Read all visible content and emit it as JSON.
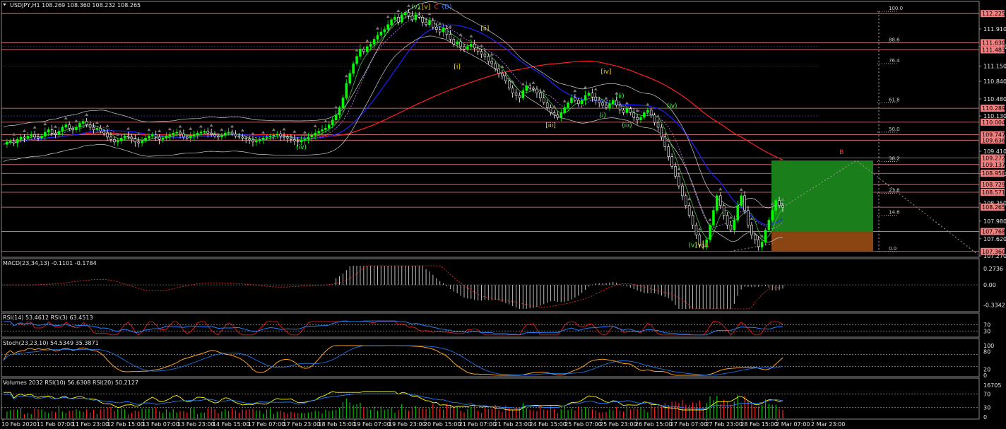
{
  "window": {
    "title": "USDJPY,H1  108.269 108.360 108.232 108.265"
  },
  "colors": {
    "background": "#000000",
    "grid": "#2a2a2a",
    "bull_candle": "#00ff00",
    "bear_candle": "#ffffff",
    "level_line": "#f08080",
    "ma_blue": "#2020ff",
    "ma_red": "#ff2020",
    "green_box": "#1a7f1a",
    "brown_box": "#8b4513",
    "macd_hist": "#c0c0c0",
    "macd_signal": "#ff3030",
    "rsi_fast": "#ff2020",
    "rsi_slow": "#2080ff",
    "stoch_main": "#ffa020",
    "stoch_signal": "#2080ff",
    "vol_up": "#00c000",
    "vol_down": "#ff2020",
    "vol_rsi_fast": "#ffff00",
    "vol_rsi_slow": "#2080ff"
  },
  "chart_data": [
    {
      "type": "candlestick",
      "title": "USDJPY,H1  108.269 108.360 108.232 108.265",
      "symbol": "USDJPY",
      "timeframe": "H1",
      "ohlc_last": {
        "open": 108.269,
        "high": 108.36,
        "low": 108.232,
        "close": 108.265
      },
      "ylim": [
        107.27,
        112.3
      ],
      "y_ticks": [
        "111.910",
        "111.550",
        "111.150",
        "110.840",
        "110.480",
        "110.130",
        "109.410",
        "108.950",
        "108.350",
        "107.980",
        "107.620",
        "107.270"
      ],
      "x_labels": [
        "10 Feb 2020",
        "11 Feb 07:00",
        "11 Feb 23:00",
        "12 Feb 15:00",
        "13 Feb 07:00",
        "13 Feb 23:00",
        "14 Feb 15:00",
        "17 Feb 07:00",
        "17 Feb 23:00",
        "18 Feb 15:00",
        "19 Feb 07:00",
        "19 Feb 23:00",
        "20 Feb 15:00",
        "21 Feb 07:00",
        "21 Feb 23:00",
        "24 Feb 15:00",
        "25 Feb 07:00",
        "25 Feb 23:00",
        "26 Feb 15:00",
        "27 Feb 07:00",
        "27 Feb 23:00",
        "28 Feb 15:00",
        "2 Mar 07:00",
        "2 Mar 23:00"
      ],
      "price_levels": [
        {
          "value": 112.225,
          "label": "112.225"
        },
        {
          "value": 111.63,
          "label": "111.630"
        },
        {
          "value": 111.483,
          "label": "111.483"
        },
        {
          "value": 110.289,
          "label": "110.289"
        },
        {
          "value": 110.004,
          "label": "110.004"
        },
        {
          "value": 109.747,
          "label": "109.747"
        },
        {
          "value": 109.636,
          "label": "109.636"
        },
        {
          "value": 109.272,
          "label": "109.272"
        },
        {
          "value": 109.137,
          "label": "109.137"
        },
        {
          "value": 108.958,
          "label": "108.958"
        },
        {
          "value": 108.729,
          "label": "108.729"
        },
        {
          "value": 108.571,
          "label": "108.571"
        },
        {
          "value": 108.265,
          "label": "108.265"
        },
        {
          "value": 107.768,
          "label": "107.768"
        },
        {
          "value": 107.36,
          "label": "107.360"
        }
      ],
      "fib_levels": [
        {
          "label": "100.0",
          "value": 112.27
        },
        {
          "label": "88.6",
          "value": 111.63
        },
        {
          "label": "76.4",
          "value": 111.2
        },
        {
          "label": "61.8",
          "value": 110.4
        },
        {
          "label": "50.0",
          "value": 109.8
        },
        {
          "label": "38.2",
          "value": 109.2
        },
        {
          "label": "23.6",
          "value": 108.55
        },
        {
          "label": "14.6",
          "value": 108.1
        },
        {
          "label": "0.0",
          "value": 107.36
        }
      ],
      "wave_labels": [
        {
          "text": "(v)",
          "color": "#40ff40",
          "series_index": 119,
          "price": 112.32
        },
        {
          "text": "[v]",
          "color": "#ffd700",
          "series_index": 122,
          "price": 112.32
        },
        {
          "text": "C",
          "color": "#ff3030",
          "series_index": 125,
          "price": 112.32
        },
        {
          "text": "(D)",
          "color": "#4080ff",
          "series_index": 128,
          "price": 112.32
        },
        {
          "text": "[ii]",
          "color": "#ffd700",
          "series_index": 139,
          "price": 111.88
        },
        {
          "text": "[i]",
          "color": "#ffd700",
          "series_index": 131,
          "price": 111.1
        },
        {
          "text": "[iv]",
          "color": "#ffd700",
          "series_index": 174,
          "price": 111.0
        },
        {
          "text": "(iv)",
          "color": "#40ff40",
          "series_index": 86,
          "price": 109.45
        },
        {
          "text": "[iii]",
          "color": "#ffd700",
          "series_index": 158,
          "price": 109.9
        },
        {
          "text": "(ii)",
          "color": "#40ff40",
          "series_index": 178,
          "price": 110.5
        },
        {
          "text": "(i)",
          "color": "#40ff40",
          "series_index": 173,
          "price": 110.1
        },
        {
          "text": "(iii)",
          "color": "#40ff40",
          "series_index": 180,
          "price": 109.9
        },
        {
          "text": "(iv)",
          "color": "#40ff40",
          "series_index": 193,
          "price": 110.3
        },
        {
          "text": "(v)",
          "color": "#40ff40",
          "series_index": 199,
          "price": 107.45
        },
        {
          "text": "[v]",
          "color": "#ffd700",
          "series_index": 201,
          "price": 107.45
        },
        {
          "text": "A",
          "color": "#ff3030",
          "series_index": 203,
          "price": 107.45
        },
        {
          "text": "B",
          "color": "#ff3030",
          "series_index": 242,
          "price": 109.35
        }
      ],
      "projection_box": {
        "profit": {
          "top": 109.22,
          "bottom": 107.76
        },
        "loss": {
          "top": 107.76,
          "bottom": 107.36
        }
      },
      "series": [
        {
          "name": "price",
          "values": [
            109.55,
            109.6,
            109.62,
            109.58,
            109.65,
            109.7,
            109.68,
            109.72,
            109.75,
            109.7,
            109.68,
            109.72,
            109.8,
            109.85,
            109.78,
            109.75,
            109.82,
            109.9,
            109.95,
            109.88,
            109.85,
            109.9,
            109.98,
            110.02,
            109.95,
            109.9,
            109.85,
            109.88,
            109.82,
            109.78,
            109.7,
            109.65,
            109.6,
            109.62,
            109.68,
            109.72,
            109.7,
            109.66,
            109.6,
            109.58,
            109.62,
            109.68,
            109.72,
            109.75,
            109.7,
            109.65,
            109.68,
            109.72,
            109.75,
            109.78,
            109.8,
            109.76,
            109.7,
            109.68,
            109.72,
            109.75,
            109.78,
            109.8,
            109.82,
            109.78,
            109.75,
            109.72,
            109.7,
            109.74,
            109.78,
            109.8,
            109.76,
            109.72,
            109.7,
            109.68,
            109.66,
            109.64,
            109.6,
            109.62,
            109.65,
            109.68,
            109.7,
            109.72,
            109.74,
            109.76,
            109.72,
            109.7,
            109.68,
            109.65,
            109.62,
            109.6,
            109.63,
            109.66,
            109.7,
            109.74,
            109.78,
            109.82,
            109.85,
            109.88,
            109.95,
            110.05,
            110.15,
            110.3,
            110.5,
            110.8,
            111.0,
            111.2,
            111.35,
            111.5,
            111.45,
            111.55,
            111.6,
            111.7,
            111.78,
            111.85,
            111.9,
            112.0,
            112.1,
            112.15,
            112.05,
            112.2,
            112.25,
            112.18,
            112.1,
            112.2,
            112.15,
            112.05,
            112.0,
            112.08,
            111.95,
            111.9,
            111.85,
            111.92,
            111.8,
            111.7,
            111.6,
            111.65,
            111.55,
            111.5,
            111.55,
            111.6,
            111.52,
            111.45,
            111.4,
            111.35,
            111.25,
            111.2,
            111.1,
            111.0,
            110.95,
            110.85,
            110.7,
            110.6,
            110.55,
            110.5,
            110.65,
            110.75,
            110.7,
            110.68,
            110.6,
            110.5,
            110.4,
            110.3,
            110.2,
            110.15,
            110.1,
            110.2,
            110.3,
            110.4,
            110.5,
            110.45,
            110.38,
            110.45,
            110.55,
            110.6,
            110.52,
            110.45,
            110.4,
            110.35,
            110.3,
            110.38,
            110.45,
            110.35,
            110.25,
            110.2,
            110.28,
            110.2,
            110.1,
            110.05,
            110.1,
            110.2,
            110.25,
            110.15,
            110.0,
            109.9,
            109.7,
            109.5,
            109.3,
            109.1,
            108.9,
            108.7,
            108.5,
            108.3,
            108.1,
            107.9,
            107.7,
            107.5,
            107.45,
            107.6,
            107.9,
            108.2,
            108.5,
            108.3,
            108.1,
            107.9,
            107.8,
            108.0,
            108.3,
            108.5,
            108.2,
            107.9,
            107.7,
            107.6,
            107.45,
            107.55,
            107.8,
            108.0,
            108.2,
            108.4,
            108.3,
            108.265
          ]
        }
      ]
    },
    {
      "type": "bar",
      "title": "MACD(23,34,13) -0.1101 -0.1784",
      "y_ticks": [
        "0.2736",
        "0.00",
        "-0.3342"
      ],
      "ylim": [
        -0.4,
        0.32
      ]
    },
    {
      "type": "line",
      "title": "RSI(14) 53.4612  RSI(3) 63.4513",
      "y_ticks": [
        "70",
        "30"
      ],
      "ylim": [
        0,
        100
      ]
    },
    {
      "type": "line",
      "title": "Stoch(23,23,10) 54.5349 35.3871",
      "y_ticks": [
        "100",
        "80",
        "20",
        "0"
      ],
      "ylim": [
        0,
        100
      ]
    },
    {
      "type": "bar",
      "title": "Volumes 2032  RSI(10) 56.6308  RSI(20) 50.2127",
      "y_ticks": [
        "16705",
        "70",
        "30",
        "0"
      ],
      "ylim": [
        0,
        100
      ]
    }
  ]
}
